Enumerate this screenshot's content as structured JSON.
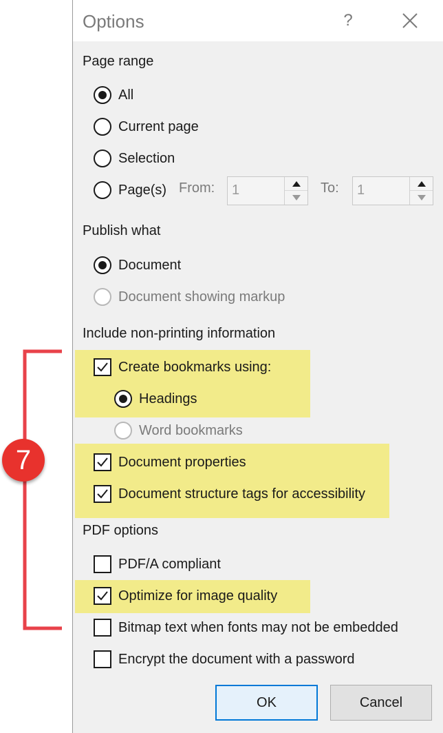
{
  "dialog": {
    "title": "Options",
    "help_label": "?",
    "close_icon": "close-icon"
  },
  "page_range": {
    "label": "Page range",
    "all_label": "All",
    "current_page_label": "Current page",
    "selection_label": "Selection",
    "pages_label": "Page(s)",
    "from_label": "From:",
    "from_value": "1",
    "to_label": "To:",
    "to_value": "1",
    "selected": "All"
  },
  "publish_what": {
    "label": "Publish what",
    "document_label": "Document",
    "markup_label": "Document showing markup",
    "selected": "Document"
  },
  "non_printing": {
    "label": "Include non-printing information",
    "create_bookmarks_label": "Create bookmarks using:",
    "create_bookmarks_checked": true,
    "headings_label": "Headings",
    "word_bookmarks_label": "Word bookmarks",
    "bookmark_source": "Headings",
    "doc_properties_label": "Document properties",
    "doc_properties_checked": true,
    "structure_tags_label": "Document structure tags for accessibility",
    "structure_tags_checked": true
  },
  "pdf_options": {
    "label": "PDF options",
    "pdfa_label": "PDF/A compliant",
    "pdfa_checked": false,
    "image_quality_label": "Optimize for image quality",
    "image_quality_checked": true,
    "bitmap_text_label": "Bitmap text when fonts may not be embedded",
    "bitmap_text_checked": false,
    "encrypt_label": "Encrypt the document with a password",
    "encrypt_checked": false
  },
  "buttons": {
    "ok_label": "OK",
    "cancel_label": "Cancel"
  },
  "annotation": {
    "badge_number": "7",
    "highlight_color": "#f2eb8a",
    "bracket_color": "#e8424a",
    "badge_color": "#e8322d"
  }
}
